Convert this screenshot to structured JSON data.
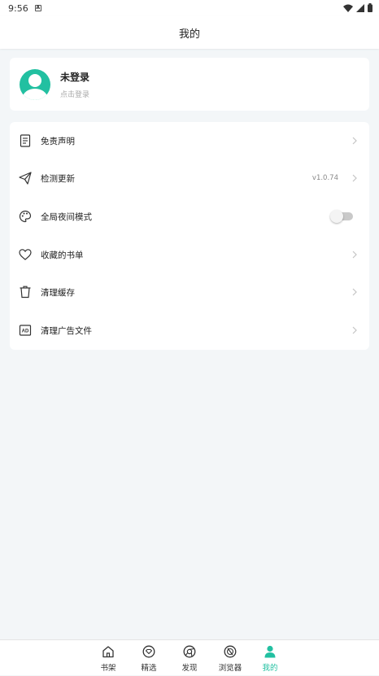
{
  "status": {
    "time": "9:56"
  },
  "header": {
    "title": "我的"
  },
  "profile": {
    "name": "未登录",
    "subtitle": "点击登录"
  },
  "menu": {
    "items": [
      {
        "label": "免责声明",
        "icon": "document-icon"
      },
      {
        "label": "检测更新",
        "icon": "send-icon",
        "version": "v1.0.74"
      },
      {
        "label": "全局夜间模式",
        "icon": "palette-icon",
        "toggle": false
      },
      {
        "label": "收藏的书单",
        "icon": "heart-icon"
      },
      {
        "label": "清理缓存",
        "icon": "trash-icon"
      },
      {
        "label": "清理广告文件",
        "icon": "ad-icon"
      }
    ]
  },
  "nav": {
    "items": [
      {
        "label": "书架",
        "icon": "home-icon"
      },
      {
        "label": "精选",
        "icon": "featured-icon"
      },
      {
        "label": "发现",
        "icon": "discover-icon"
      },
      {
        "label": "浏览器",
        "icon": "browser-icon"
      },
      {
        "label": "我的",
        "icon": "user-icon",
        "active": true
      }
    ]
  },
  "colors": {
    "accent": "#22c0a1",
    "background": "#f3f6f8"
  }
}
